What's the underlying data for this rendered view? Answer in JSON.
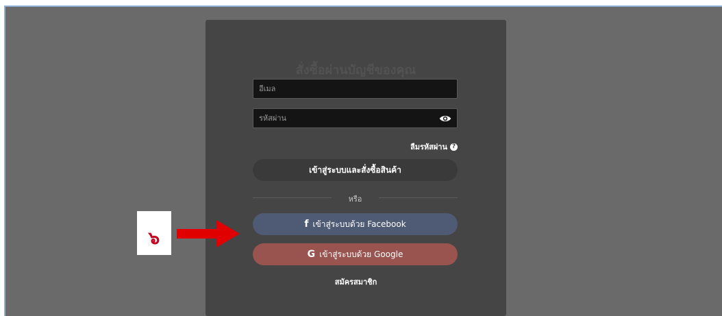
{
  "login_form": {
    "title": "สั่งซื้อผ่านบัญชีของคุณ",
    "email_placeholder": "อีเมล",
    "password_placeholder": "รหัสผ่าน",
    "forgot_password": "ลืมรหัสผ่าน",
    "login_button": "เข้าสู่ระบบและสั่งซื้อสินค้า",
    "or_text": "หรือ",
    "facebook_button": "เข้าสู่ระบบด้วย Facebook",
    "google_button": "เข้าสู่ระบบด้วย Google",
    "signup_link": "สมัครสมาชิก"
  },
  "annotation": {
    "step_number": "๖"
  },
  "icons": {
    "facebook": "f",
    "google": "G",
    "help": "?"
  },
  "colors": {
    "facebook": "#4f5a74",
    "google": "#9a5450",
    "arrow": "#e00000"
  }
}
